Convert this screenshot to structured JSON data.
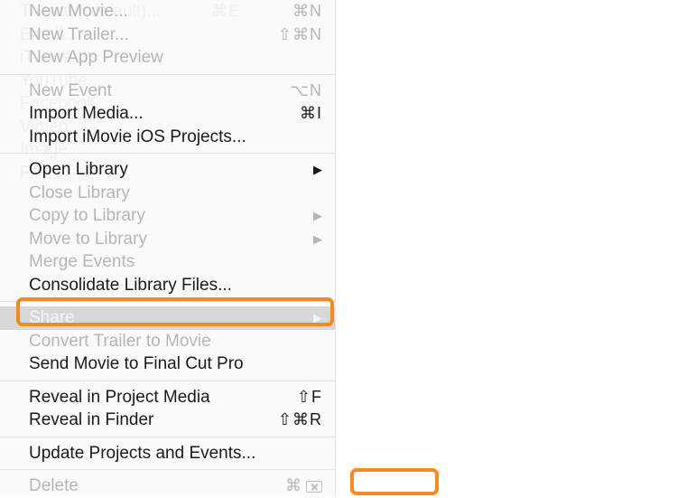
{
  "mainMenu": {
    "group1": [
      {
        "label": "New Movie...",
        "shortcut": "⌘N",
        "enabled": false
      },
      {
        "label": "New Trailer...",
        "shortcut": "⇧⌘N",
        "enabled": false
      },
      {
        "label": "New App Preview",
        "shortcut": "",
        "enabled": false
      }
    ],
    "group2": [
      {
        "label": "New Event",
        "shortcut": "⌥N",
        "enabled": false
      },
      {
        "label": "Import Media...",
        "shortcut": "⌘I",
        "enabled": true
      },
      {
        "label": "Import iMovie iOS Projects...",
        "shortcut": "",
        "enabled": true
      }
    ],
    "group3": [
      {
        "label": "Open Library",
        "submenu": true,
        "enabled": true
      },
      {
        "label": "Close Library",
        "enabled": false
      },
      {
        "label": "Copy to Library",
        "submenu": true,
        "enabled": false
      },
      {
        "label": "Move to Library",
        "submenu": true,
        "enabled": false
      },
      {
        "label": "Merge Events",
        "enabled": false
      },
      {
        "label": "Consolidate Library Files...",
        "enabled": true
      }
    ],
    "group4": [
      {
        "label": "Share",
        "submenu": true,
        "enabled": true,
        "selected": true
      },
      {
        "label": "Convert Trailer to Movie",
        "enabled": false
      },
      {
        "label": "Send Movie to Final Cut Pro",
        "enabled": true
      }
    ],
    "group5": [
      {
        "label": "Reveal in Project Media",
        "shortcut": "⇧F",
        "enabled": true
      },
      {
        "label": "Reveal in Finder",
        "shortcut": "⇧⌘R",
        "enabled": true
      }
    ],
    "group6": [
      {
        "label": "Update Projects and Events...",
        "enabled": true
      }
    ],
    "group7": [
      {
        "label": "Delete",
        "shortcut": "⌘",
        "deleteIcon": true,
        "enabled": false
      }
    ]
  },
  "shareSubmenu": [
    {
      "label": "Theater (default)...",
      "shortcut": "⌘E"
    },
    {
      "label": "Email..."
    },
    {
      "label": "iTunes..."
    },
    {
      "label": "YouTube..."
    },
    {
      "label": "Facebook..."
    },
    {
      "label": "Vimeo..."
    },
    {
      "label": "Image..."
    },
    {
      "label": "File..."
    }
  ]
}
